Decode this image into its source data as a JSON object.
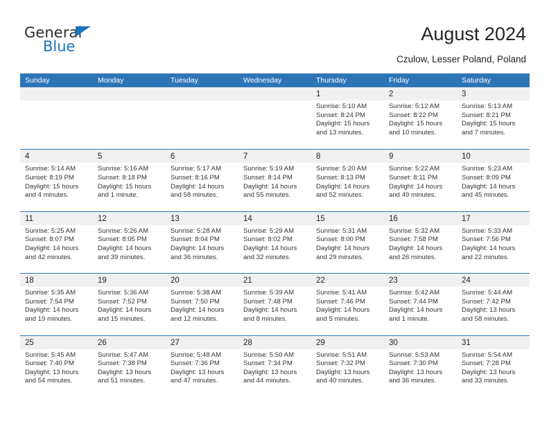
{
  "brand": {
    "name_part1": "General",
    "name_part2": "Blue",
    "accent_color": "#1b75bc"
  },
  "header": {
    "title": "August 2024",
    "subtitle": "Czulow, Lesser Poland, Poland",
    "header_bar_color": "#2e75b6"
  },
  "calendar": {
    "weekday_headers": [
      "Sunday",
      "Monday",
      "Tuesday",
      "Wednesday",
      "Thursday",
      "Friday",
      "Saturday"
    ],
    "weeks": [
      [
        {
          "day": "",
          "sunrise": "",
          "sunset": "",
          "daylight": ""
        },
        {
          "day": "",
          "sunrise": "",
          "sunset": "",
          "daylight": ""
        },
        {
          "day": "",
          "sunrise": "",
          "sunset": "",
          "daylight": ""
        },
        {
          "day": "",
          "sunrise": "",
          "sunset": "",
          "daylight": ""
        },
        {
          "day": "1",
          "sunrise": "Sunrise: 5:10 AM",
          "sunset": "Sunset: 8:24 PM",
          "daylight": "Daylight: 15 hours and 13 minutes."
        },
        {
          "day": "2",
          "sunrise": "Sunrise: 5:12 AM",
          "sunset": "Sunset: 8:22 PM",
          "daylight": "Daylight: 15 hours and 10 minutes."
        },
        {
          "day": "3",
          "sunrise": "Sunrise: 5:13 AM",
          "sunset": "Sunset: 8:21 PM",
          "daylight": "Daylight: 15 hours and 7 minutes."
        }
      ],
      [
        {
          "day": "4",
          "sunrise": "Sunrise: 5:14 AM",
          "sunset": "Sunset: 8:19 PM",
          "daylight": "Daylight: 15 hours and 4 minutes."
        },
        {
          "day": "5",
          "sunrise": "Sunrise: 5:16 AM",
          "sunset": "Sunset: 8:18 PM",
          "daylight": "Daylight: 15 hours and 1 minute."
        },
        {
          "day": "6",
          "sunrise": "Sunrise: 5:17 AM",
          "sunset": "Sunset: 8:16 PM",
          "daylight": "Daylight: 14 hours and 58 minutes."
        },
        {
          "day": "7",
          "sunrise": "Sunrise: 5:19 AM",
          "sunset": "Sunset: 8:14 PM",
          "daylight": "Daylight: 14 hours and 55 minutes."
        },
        {
          "day": "8",
          "sunrise": "Sunrise: 5:20 AM",
          "sunset": "Sunset: 8:13 PM",
          "daylight": "Daylight: 14 hours and 52 minutes."
        },
        {
          "day": "9",
          "sunrise": "Sunrise: 5:22 AM",
          "sunset": "Sunset: 8:11 PM",
          "daylight": "Daylight: 14 hours and 49 minutes."
        },
        {
          "day": "10",
          "sunrise": "Sunrise: 5:23 AM",
          "sunset": "Sunset: 8:09 PM",
          "daylight": "Daylight: 14 hours and 45 minutes."
        }
      ],
      [
        {
          "day": "11",
          "sunrise": "Sunrise: 5:25 AM",
          "sunset": "Sunset: 8:07 PM",
          "daylight": "Daylight: 14 hours and 42 minutes."
        },
        {
          "day": "12",
          "sunrise": "Sunrise: 5:26 AM",
          "sunset": "Sunset: 8:05 PM",
          "daylight": "Daylight: 14 hours and 39 minutes."
        },
        {
          "day": "13",
          "sunrise": "Sunrise: 5:28 AM",
          "sunset": "Sunset: 8:04 PM",
          "daylight": "Daylight: 14 hours and 36 minutes."
        },
        {
          "day": "14",
          "sunrise": "Sunrise: 5:29 AM",
          "sunset": "Sunset: 8:02 PM",
          "daylight": "Daylight: 14 hours and 32 minutes."
        },
        {
          "day": "15",
          "sunrise": "Sunrise: 5:31 AM",
          "sunset": "Sunset: 8:00 PM",
          "daylight": "Daylight: 14 hours and 29 minutes."
        },
        {
          "day": "16",
          "sunrise": "Sunrise: 5:32 AM",
          "sunset": "Sunset: 7:58 PM",
          "daylight": "Daylight: 14 hours and 26 minutes."
        },
        {
          "day": "17",
          "sunrise": "Sunrise: 5:33 AM",
          "sunset": "Sunset: 7:56 PM",
          "daylight": "Daylight: 14 hours and 22 minutes."
        }
      ],
      [
        {
          "day": "18",
          "sunrise": "Sunrise: 5:35 AM",
          "sunset": "Sunset: 7:54 PM",
          "daylight": "Daylight: 14 hours and 19 minutes."
        },
        {
          "day": "19",
          "sunrise": "Sunrise: 5:36 AM",
          "sunset": "Sunset: 7:52 PM",
          "daylight": "Daylight: 14 hours and 15 minutes."
        },
        {
          "day": "20",
          "sunrise": "Sunrise: 5:38 AM",
          "sunset": "Sunset: 7:50 PM",
          "daylight": "Daylight: 14 hours and 12 minutes."
        },
        {
          "day": "21",
          "sunrise": "Sunrise: 5:39 AM",
          "sunset": "Sunset: 7:48 PM",
          "daylight": "Daylight: 14 hours and 8 minutes."
        },
        {
          "day": "22",
          "sunrise": "Sunrise: 5:41 AM",
          "sunset": "Sunset: 7:46 PM",
          "daylight": "Daylight: 14 hours and 5 minutes."
        },
        {
          "day": "23",
          "sunrise": "Sunrise: 5:42 AM",
          "sunset": "Sunset: 7:44 PM",
          "daylight": "Daylight: 14 hours and 1 minute."
        },
        {
          "day": "24",
          "sunrise": "Sunrise: 5:44 AM",
          "sunset": "Sunset: 7:42 PM",
          "daylight": "Daylight: 13 hours and 58 minutes."
        }
      ],
      [
        {
          "day": "25",
          "sunrise": "Sunrise: 5:45 AM",
          "sunset": "Sunset: 7:40 PM",
          "daylight": "Daylight: 13 hours and 54 minutes."
        },
        {
          "day": "26",
          "sunrise": "Sunrise: 5:47 AM",
          "sunset": "Sunset: 7:38 PM",
          "daylight": "Daylight: 13 hours and 51 minutes."
        },
        {
          "day": "27",
          "sunrise": "Sunrise: 5:48 AM",
          "sunset": "Sunset: 7:36 PM",
          "daylight": "Daylight: 13 hours and 47 minutes."
        },
        {
          "day": "28",
          "sunrise": "Sunrise: 5:50 AM",
          "sunset": "Sunset: 7:34 PM",
          "daylight": "Daylight: 13 hours and 44 minutes."
        },
        {
          "day": "29",
          "sunrise": "Sunrise: 5:51 AM",
          "sunset": "Sunset: 7:32 PM",
          "daylight": "Daylight: 13 hours and 40 minutes."
        },
        {
          "day": "30",
          "sunrise": "Sunrise: 5:53 AM",
          "sunset": "Sunset: 7:30 PM",
          "daylight": "Daylight: 13 hours and 36 minutes."
        },
        {
          "day": "31",
          "sunrise": "Sunrise: 5:54 AM",
          "sunset": "Sunset: 7:28 PM",
          "daylight": "Daylight: 13 hours and 33 minutes."
        }
      ]
    ]
  }
}
